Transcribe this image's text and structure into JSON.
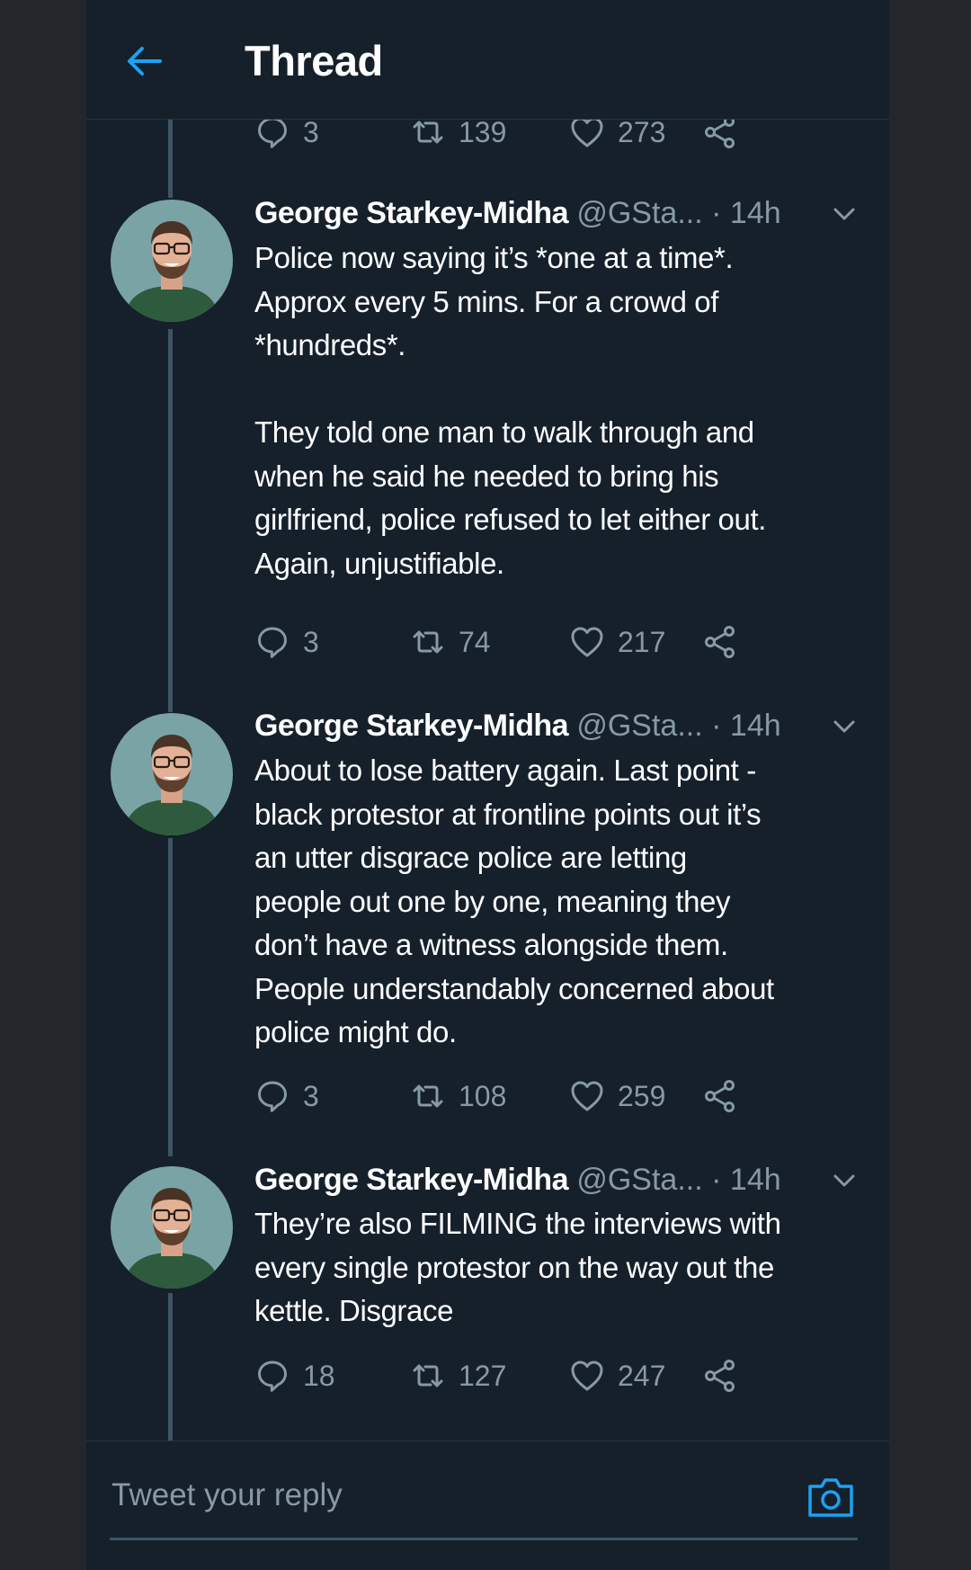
{
  "header": {
    "title": "Thread"
  },
  "prev_tweet_actions": {
    "replies": "3",
    "retweets": "139",
    "likes": "273"
  },
  "tweets": [
    {
      "name": "George Starkey-Midha",
      "handle": "@GSta...",
      "separator": "·",
      "time": "14h",
      "text": "Police now saying it’s *one at a time*.\nApprox every 5 mins. For a crowd of\n*hundreds*.\n\nThey told one man to walk through and\nwhen he said he needed to bring his\ngirlfriend, police refused to let either out.\nAgain, unjustifiable.",
      "replies": "3",
      "retweets": "74",
      "likes": "217"
    },
    {
      "name": "George Starkey-Midha",
      "handle": "@GSta...",
      "separator": "·",
      "time": "14h",
      "text": "About to lose battery again. Last point -\nblack protestor at frontline points out it’s\nan utter disgrace police are letting\npeople out one by one, meaning they\ndon’t have a witness alongside them.\nPeople understandably concerned about\npolice might do.",
      "replies": "3",
      "retweets": "108",
      "likes": "259"
    },
    {
      "name": "George Starkey-Midha",
      "handle": "@GSta...",
      "separator": "·",
      "time": "14h",
      "text": "They’re also FILMING the interviews with\nevery single protestor on the way out the\nkettle. Disgrace",
      "replies": "18",
      "retweets": "127",
      "likes": "247"
    }
  ],
  "reply": {
    "placeholder": "Tweet your reply"
  },
  "icons": {
    "back": "arrow-left-icon",
    "reply": "reply-bubble-icon",
    "retweet": "retweet-icon",
    "like": "heart-icon",
    "share": "share-icon",
    "more": "chevron-down-icon",
    "camera": "camera-icon"
  },
  "colors": {
    "background": "#15202b",
    "accent": "#1da1f2",
    "text": "#ffffff",
    "muted": "#8899a6",
    "thread_line": "#3d5466"
  }
}
